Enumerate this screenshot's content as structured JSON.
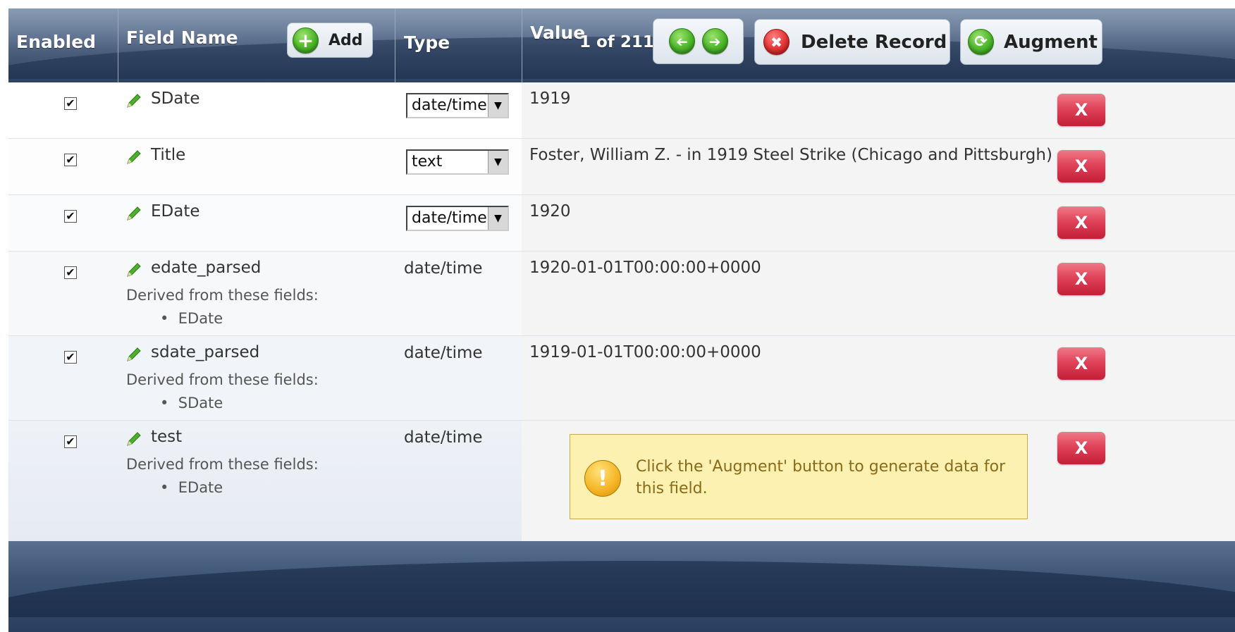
{
  "header": {
    "enabled_label": "Enabled",
    "field_name_label": "Field Name",
    "add_label": "Add",
    "type_label": "Type",
    "value_label": "Value",
    "record_counter": "1 of 211",
    "delete_record_label": "Delete Record",
    "augment_label": "Augment"
  },
  "rows": [
    {
      "name": "SDate",
      "enabled": true,
      "type": "date/time",
      "type_is_select": true,
      "value": "1919",
      "remove_label": "X"
    },
    {
      "name": "Title",
      "enabled": true,
      "type": "text",
      "type_is_select": true,
      "value": "Foster, William Z. - in 1919 Steel Strike (Chicago and Pittsburgh)",
      "remove_label": "X"
    },
    {
      "name": "EDate",
      "enabled": true,
      "type": "date/time",
      "type_is_select": true,
      "value": "1920",
      "remove_label": "X"
    },
    {
      "name": "edate_parsed",
      "enabled": true,
      "type": "date/time",
      "type_is_select": false,
      "value": "1920-01-01T00:00:00+0000",
      "derived_label": "Derived from these fields:",
      "derived_from": [
        "EDate"
      ],
      "remove_label": "X"
    },
    {
      "name": "sdate_parsed",
      "enabled": true,
      "type": "date/time",
      "type_is_select": false,
      "value": "1919-01-01T00:00:00+0000",
      "derived_label": "Derived from these fields:",
      "derived_from": [
        "SDate"
      ],
      "remove_label": "X"
    },
    {
      "name": "test",
      "enabled": true,
      "type": "date/time",
      "type_is_select": false,
      "value": "",
      "derived_label": "Derived from these fields:",
      "derived_from": [
        "EDate"
      ],
      "remove_label": "X"
    }
  ],
  "warning": {
    "icon": "exclamation-icon",
    "message": "Click the 'Augment' button to generate data for this field."
  },
  "icons": {
    "add": "plus-icon",
    "prev": "arrow-left-icon",
    "next": "arrow-right-icon",
    "delete": "x-circle-icon",
    "augment": "refresh-icon",
    "edit": "pencil-icon",
    "checkbox_mark": "✔"
  },
  "colors": {
    "header_dark": "#2e4262",
    "remove_button": "#d9334c",
    "warning_bg": "#fcf1b1",
    "warning_text": "#8a6a18",
    "add_green": "#4bb52a"
  }
}
